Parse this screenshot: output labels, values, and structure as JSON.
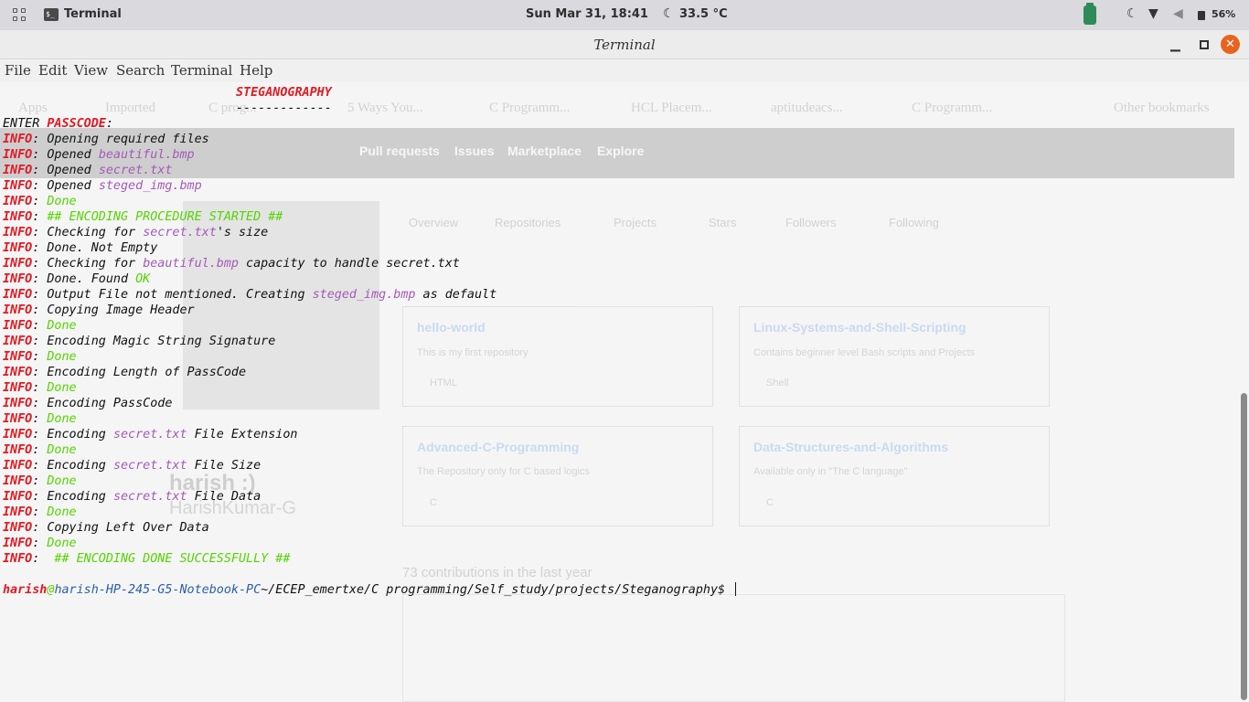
{
  "topbar": {
    "app_name": "Terminal",
    "app_icon_text": "$_",
    "clock": "Sun Mar 31, 18:41",
    "weather": "33.5 °C",
    "battery": "56%"
  },
  "window": {
    "title": "Terminal"
  },
  "menu": {
    "file": "File",
    "edit": "Edit",
    "view": "View",
    "search": "Search",
    "terminal": "Terminal",
    "help": "Help"
  },
  "terminal": {
    "header": "STEGANOGRAPHY",
    "underline": "-------------",
    "passcode_prefix": "ENTER ",
    "passcode_word": "PASSCODE",
    "passcode_suffix": ":",
    "info_tag": "INFO",
    "colon": ": ",
    "l_open": "Opening required files",
    "opened": "Opened ",
    "beautiful": "beautiful.bmp",
    "secret": "secret.txt",
    "steged": "steged_img.bmp",
    "done": "Done",
    "enc_started": "## ENCODING PROCEDURE STARTED ##",
    "checking_for": "Checking for ",
    "size_suffix": "'s size",
    "not_empty": "Done. Not Empty",
    "capacity_suffix": " capacity to handle secret.txt",
    "found": "Done. Found ",
    "ok": "OK",
    "output_prefix": "Output File not mentioned. Creating ",
    "output_suffix": " as default",
    "copy_header": "Copying Image Header",
    "enc_magic": "Encoding Magic String Signature",
    "enc_len": "Encoding Length of PassCode",
    "enc_pass": "Encoding PassCode",
    "encoding": "Encoding ",
    "file_ext": " File Extension",
    "file_size": " File Size",
    "file_data": " File Data",
    "copy_left": "Copying Left Over Data",
    "enc_done": " ## ENCODING DONE SUCCESSFULLY ##",
    "prompt_user": "harish",
    "prompt_at": "@",
    "prompt_host": "harish-HP-245-G5-Notebook-PC",
    "prompt_path": "~/ECEP_emertxe/C programming/Self_study/projects/Steganography",
    "prompt_end": "$ "
  },
  "background_ghost": {
    "bookmarks": [
      "Apps",
      "Imported",
      "C prog...",
      "5 Ways You...",
      "C Programm...",
      "HCL Placem...",
      "aptitudeacs...",
      "C Programm...",
      "Other bookmarks"
    ],
    "nav": [
      "Pull requests",
      "Issues",
      "Marketplace",
      "Explore"
    ],
    "tabs": [
      "Overview",
      "Repositories",
      "Projects",
      "Stars",
      "Followers",
      "Following"
    ],
    "repos": [
      {
        "name": "hello-world",
        "desc": "This is my first repository",
        "lang": "HTML"
      },
      {
        "name": "Linux-Systems-and-Shell-Scripting",
        "desc": "Contains beginner level Bash scripts and Projects",
        "lang": "Shell"
      },
      {
        "name": "Advanced-C-Programming",
        "desc": "The Repository only for C based logics",
        "lang": "C"
      },
      {
        "name": "Data-Structures-and-Algorithms",
        "desc": "Available only in \"The C language\"",
        "lang": "C"
      }
    ],
    "profile_name": "harish :)",
    "profile_user": "HarishKumar-G",
    "contributions": "73 contributions in the last year"
  }
}
